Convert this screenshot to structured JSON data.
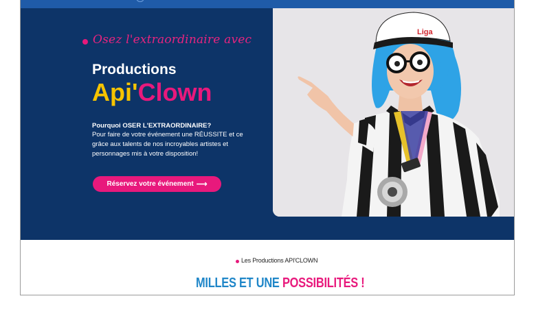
{
  "hero": {
    "tagline": "Osez l'extraordinaire avec",
    "title_line1": "Productions",
    "brand_part1": "Api'",
    "brand_part2": "Clown",
    "question": "Pourquoi OSER L'EXTRAORDINAIRE?",
    "description": "Pour faire de votre événement une RÉUSSITE et ce grâce aux talents de nos incroyables artistes et personnages mis à votre disposition!",
    "cta_label": "Réservez votre événement",
    "cta_icon": "arrow-right-icon",
    "cap_text": "Liga"
  },
  "section": {
    "kicker": "Les Productions API'CLOWN",
    "title_part1": "MILLES ET UNE",
    "title_part2": "POSSIBILITÉS !"
  },
  "colors": {
    "navy": "#0d3468",
    "pink": "#e8197c",
    "yellow": "#f6c400",
    "blue": "#1f86c8"
  }
}
